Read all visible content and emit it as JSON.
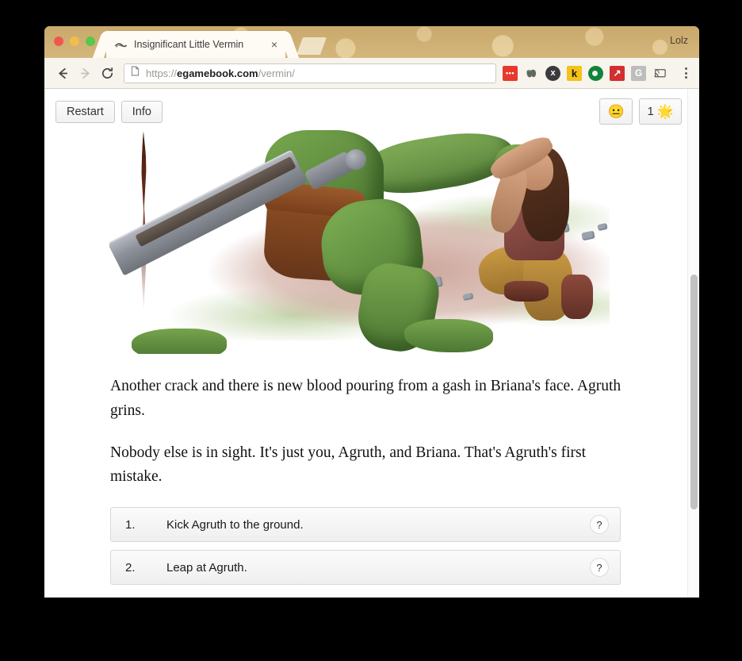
{
  "browser": {
    "profile_name": "Lolz",
    "tab": {
      "title": "Insignificant Little Vermin",
      "favicon": "book-swoosh-icon",
      "close_label": "×"
    },
    "new_tab_label": "",
    "nav": {
      "back": "←",
      "forward": "→",
      "reload": "⟳"
    },
    "url": {
      "scheme": "https://",
      "host": "egamebook.com",
      "path": "/vermin/",
      "page_icon": "document-icon"
    },
    "extensions": [
      {
        "name": "red-dots-extension-icon",
        "label": "•••",
        "color": "#e8392d",
        "text_color": "#ffffff"
      },
      {
        "name": "evernote-extension-icon",
        "label": "",
        "color": "#00000000",
        "text_color": "#5b6b5b"
      },
      {
        "name": "dark-x-extension-icon",
        "label": "x",
        "color": "#3b3b3b",
        "text_color": "#ffffff"
      },
      {
        "name": "kindle-k-extension-icon",
        "label": "k",
        "color": "#f5c21b",
        "text_color": "#1a1a1a"
      },
      {
        "name": "green-circle-extension-icon",
        "label": "",
        "color": "#12833a",
        "text_color": "#ffffff"
      },
      {
        "name": "red-arrow-extension-icon",
        "label": "↗",
        "color": "#d32f2f",
        "text_color": "#ffffff"
      },
      {
        "name": "google-g-extension-icon",
        "label": "G",
        "color": "#bdbdbd",
        "text_color": "#ffffff"
      },
      {
        "name": "cast-extension-icon",
        "label": "",
        "color": "#00000000",
        "text_color": "#5a5a5a"
      }
    ],
    "menu": "chrome-menu-icon"
  },
  "app": {
    "toolbar": {
      "restart_label": "Restart",
      "info_label": "Info",
      "mood_emoji": "😐",
      "points_value": "1",
      "points_icon": "🌟"
    },
    "illustration": {
      "name": "battle-scene-illustration",
      "alt": "A green orc with a large sword looms over a kneeling woman on dusty ground"
    },
    "paragraphs": [
      "Another crack and there is new blood pouring from a gash in Briana's face. Agruth grins.",
      "Nobody else is in sight. It's just you, Agruth, and Briana. That's Agruth's first mistake."
    ],
    "choices": [
      {
        "number": "1.",
        "text": "Kick Agruth to the ground.",
        "help": "?"
      },
      {
        "number": "2.",
        "text": "Leap at Agruth.",
        "help": "?"
      }
    ]
  }
}
